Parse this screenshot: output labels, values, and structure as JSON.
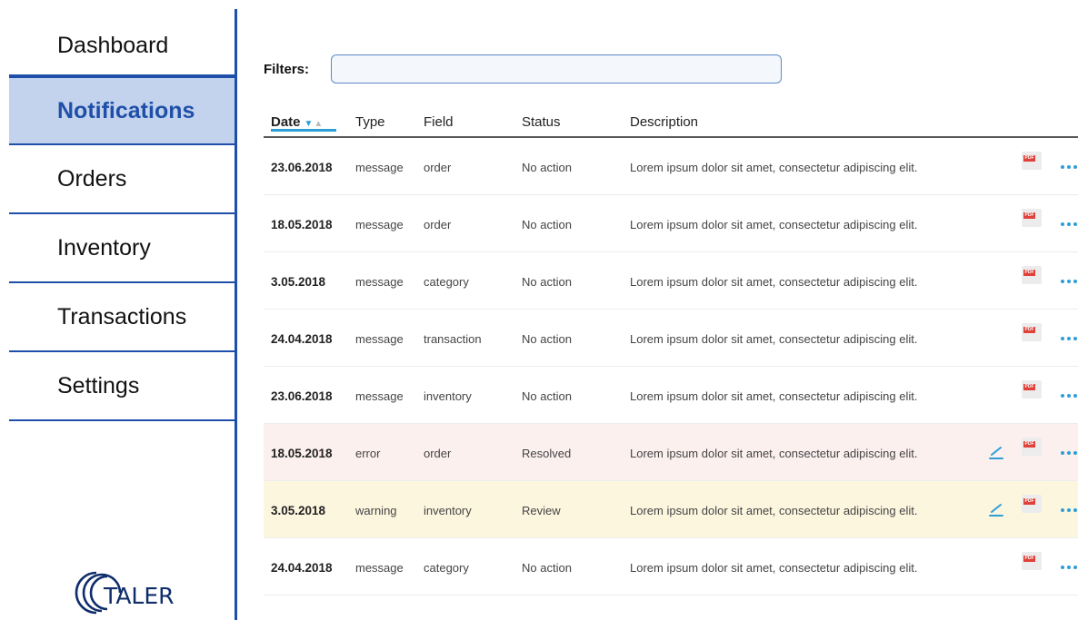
{
  "sidebar": {
    "items": [
      {
        "label": "Dashboard",
        "active": false
      },
      {
        "label": "Notifications",
        "active": true
      },
      {
        "label": "Orders",
        "active": false
      },
      {
        "label": "Inventory",
        "active": false
      },
      {
        "label": "Transactions",
        "active": false
      },
      {
        "label": "Settings",
        "active": false
      }
    ],
    "logo_text": "TALER"
  },
  "filters": {
    "label": "Filters:",
    "value": "",
    "placeholder": ""
  },
  "table": {
    "columns": [
      "Date",
      "Type",
      "Field",
      "Status",
      "Description"
    ],
    "sort": {
      "column": "Date",
      "direction": "desc"
    },
    "rows": [
      {
        "date": "23.06.2018",
        "type": "message",
        "field": "order",
        "status": "No action",
        "description": "Lorem ipsum dolor sit amet, consectetur adipiscing elit.",
        "variant": "normal",
        "editable": false
      },
      {
        "date": "18.05.2018",
        "type": "message",
        "field": "order",
        "status": "No action",
        "description": "Lorem ipsum dolor sit amet, consectetur adipiscing elit.",
        "variant": "normal",
        "editable": false
      },
      {
        "date": "3.05.2018",
        "type": "message",
        "field": "category",
        "status": "No action",
        "description": "Lorem ipsum dolor sit amet, consectetur adipiscing elit.",
        "variant": "normal",
        "editable": false
      },
      {
        "date": "24.04.2018",
        "type": "message",
        "field": "transaction",
        "status": "No action",
        "description": "Lorem ipsum dolor sit amet, consectetur adipiscing elit.",
        "variant": "normal",
        "editable": false
      },
      {
        "date": "23.06.2018",
        "type": "message",
        "field": "inventory",
        "status": "No action",
        "description": "Lorem ipsum dolor sit amet, consectetur adipiscing elit.",
        "variant": "normal",
        "editable": false
      },
      {
        "date": "18.05.2018",
        "type": "error",
        "field": "order",
        "status": "Resolved",
        "description": "Lorem ipsum dolor sit amet, consectetur adipiscing elit.",
        "variant": "error",
        "editable": true
      },
      {
        "date": "3.05.2018",
        "type": "warning",
        "field": "inventory",
        "status": "Review",
        "description": "Lorem ipsum dolor sit amet, consectetur adipiscing elit.",
        "variant": "warning",
        "editable": true
      },
      {
        "date": "24.04.2018",
        "type": "message",
        "field": "category",
        "status": "No action",
        "description": "Lorem ipsum dolor sit amet, consectetur adipiscing elit.",
        "variant": "normal",
        "editable": false
      }
    ],
    "pdf_tag": "PDF"
  },
  "icons": {
    "edit": "pencil-icon",
    "pdf": "pdf-file-icon",
    "more": "more-dots-icon",
    "sort": "sort-arrow-icon"
  },
  "colors": {
    "accent": "#1f4fa8",
    "active_bg": "#c3d3ee",
    "link_blue": "#2d9fd8",
    "error_row": "#fcf0ef",
    "warning_row": "#fdf6df",
    "pdf_red": "#e0413a"
  }
}
